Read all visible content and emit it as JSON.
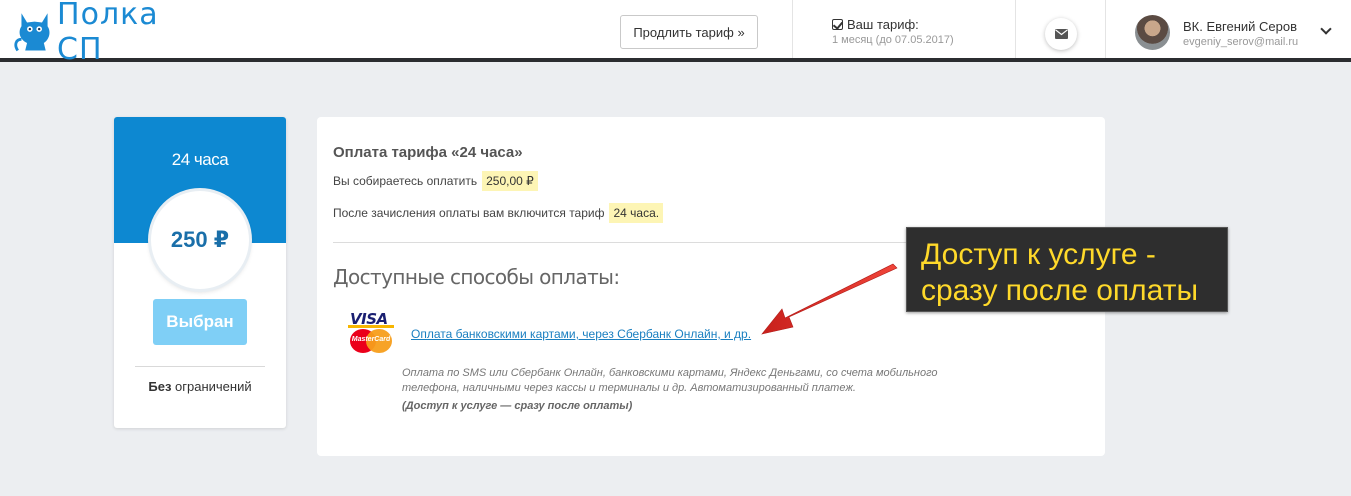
{
  "header": {
    "logo_text": "Полка СП",
    "extend_button": "Продлить тариф »",
    "tariff": {
      "title": "Ваш тариф:",
      "subtitle": "1 месяц (до 07.05.2017)"
    },
    "user": {
      "name": "ВК. Евгений Серов",
      "email": "evgeniy_serov@mail.ru"
    }
  },
  "plan_card": {
    "name": "24 часа",
    "price": "250 ₽",
    "button": "Выбран",
    "limit_bold": "Без",
    "limit_rest": " ограничений"
  },
  "payment": {
    "title": "Оплата тарифа «24 часа»",
    "line1_text": "Вы собираетесь оплатить",
    "line1_value": "250,00 ₽",
    "line2_text": "После зачисления оплаты вам включится тариф",
    "line2_value": "24 часа.",
    "methods_title": "Доступные способы оплаты:",
    "card_logo": {
      "visa": "VISA",
      "mastercard": "MasterCard"
    },
    "link": "Оплата банковскими картами, через Сбербанк Онлайн, и др.",
    "description": "Оплата по SMS или Сбербанк Онлайн, банковскими картами, Яндекс Деньгами, со счета мобильного телефона, наличными через кассы и терминалы и др. Автоматизированный платеж.",
    "note": "(Доступ к услуге — сразу после оплаты)"
  },
  "callout": {
    "line1": "Доступ к услуге -",
    "line2": "сразу после оплаты"
  },
  "colors": {
    "brand_blue": "#0d88d1",
    "link_blue": "#1a7fc0",
    "highlight": "#fdf5b5",
    "callout_text": "#ffd92a",
    "arrow_red": "#e8302a"
  }
}
